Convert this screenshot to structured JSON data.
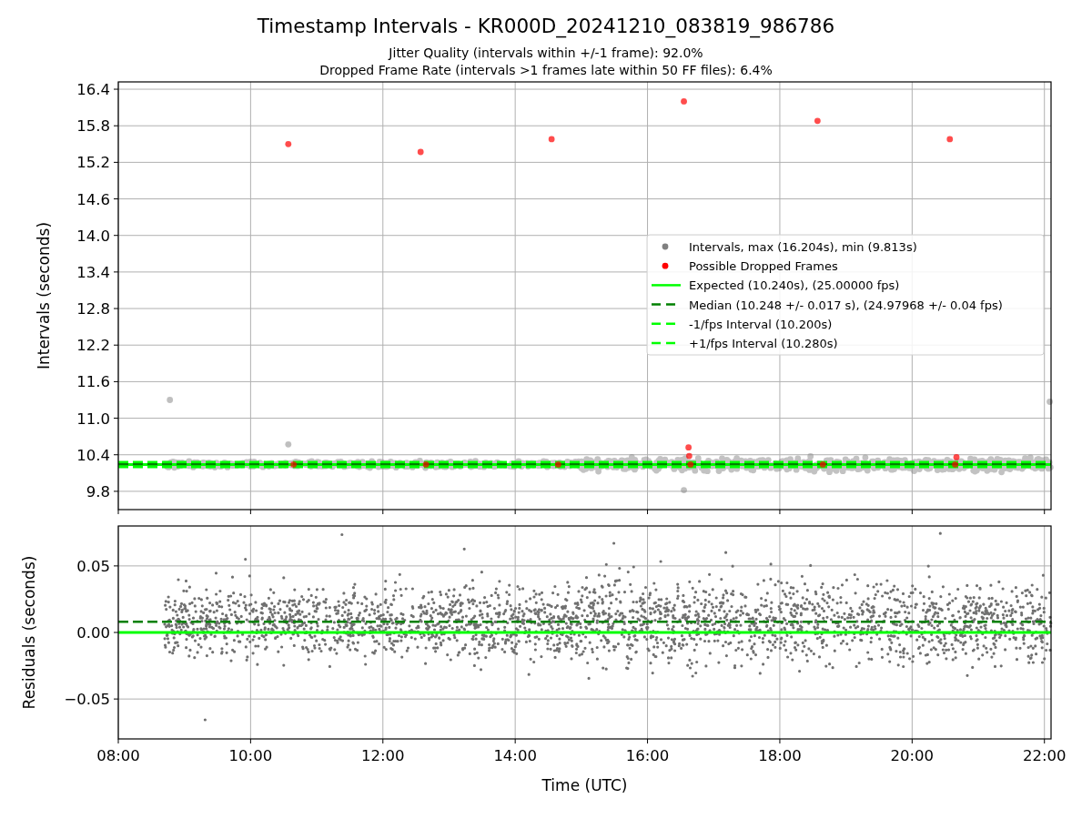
{
  "figure": {
    "title": "Timestamp Intervals - KR000D_20241210_083819_986786",
    "subtitles": [
      "Jitter Quality (intervals within +/-1 frame): 92.0%",
      "Dropped Frame Rate (intervals >1 frames late within 50 FF files): 6.4%"
    ]
  },
  "intervals_plot": {
    "chart_data": {
      "type": "scatter",
      "ylabel": "Intervals (seconds)",
      "grid": true,
      "xlim": [
        8,
        22.1
      ],
      "ylim": [
        9.5,
        16.52
      ],
      "yticks": [
        {
          "value": 9.8,
          "label": "9.8"
        },
        {
          "value": 10.4,
          "label": "10.4"
        },
        {
          "value": 11.0,
          "label": "11.0"
        },
        {
          "value": 11.6,
          "label": "11.6"
        },
        {
          "value": 12.2,
          "label": "12.2"
        },
        {
          "value": 12.8,
          "label": "12.8"
        },
        {
          "value": 13.4,
          "label": "13.4"
        },
        {
          "value": 14.0,
          "label": "14.0"
        },
        {
          "value": 14.6,
          "label": "14.6"
        },
        {
          "value": 15.2,
          "label": "15.2"
        },
        {
          "value": 15.8,
          "label": "15.8"
        },
        {
          "value": 16.4,
          "label": "16.4"
        }
      ],
      "series": [
        {
          "name": "Intervals, max (16.204s), min (9.813s)",
          "color": "#808080",
          "x": [
            8.78,
            10.57,
            16.55,
            22.08
          ],
          "values": [
            11.3,
            10.57,
            9.82,
            11.27
          ]
        },
        {
          "name": "Possible Dropped Frames",
          "color": "#ff0000",
          "x": [
            10.57,
            12.57,
            14.55,
            16.55,
            18.57,
            20.57,
            10.65,
            12.65,
            14.65,
            16.65,
            16.63,
            16.62,
            18.65,
            20.65,
            20.67
          ],
          "values": [
            15.5,
            15.37,
            15.58,
            16.2,
            15.88,
            15.58,
            10.24,
            10.24,
            10.24,
            10.24,
            10.38,
            10.52,
            10.24,
            10.24,
            10.36
          ]
        }
      ],
      "legend": true,
      "ref_lines": [
        {
          "axis": "y",
          "value": 10.24,
          "label": "Expected (10.240s), (25.00000 fps)",
          "color": "#00ff00"
        },
        {
          "axis": "y",
          "value": 10.248,
          "label": "Median (10.248 +/- 0.017 s), (24.97968 +/- 0.04 fps)",
          "color": "#008000"
        },
        {
          "axis": "y",
          "value": 10.2,
          "label": "-1/fps Interval (10.200s)",
          "color": "#00ff00"
        },
        {
          "axis": "y",
          "value": 10.28,
          "label": "+1/fps Interval (10.280s)",
          "color": "#00ff00"
        }
      ]
    }
  },
  "residuals_plot": {
    "chart_data": {
      "type": "scatter",
      "xlabel": "Time (UTC)",
      "ylabel": "Residuals (seconds)",
      "grid": true,
      "xlim": [
        8,
        22.1
      ],
      "ylim": [
        -0.08,
        0.08
      ],
      "xticks": [
        {
          "value": 8,
          "label": "08:00"
        },
        {
          "value": 10,
          "label": "10:00"
        },
        {
          "value": 12,
          "label": "12:00"
        },
        {
          "value": 14,
          "label": "14:00"
        },
        {
          "value": 16,
          "label": "16:00"
        },
        {
          "value": 18,
          "label": "18:00"
        },
        {
          "value": 20,
          "label": "20:00"
        },
        {
          "value": 22,
          "label": "22:00"
        }
      ],
      "yticks": [
        {
          "value": 0.05,
          "label": "0.05"
        },
        {
          "value": 0,
          "label": "0.00"
        },
        {
          "value": -0.05,
          "label": "−0.05"
        }
      ],
      "ref_lines": [
        {
          "axis": "y",
          "value": 0,
          "color": "#00ff00"
        },
        {
          "axis": "y",
          "value": 0.008,
          "color": "#008000"
        }
      ]
    }
  }
}
